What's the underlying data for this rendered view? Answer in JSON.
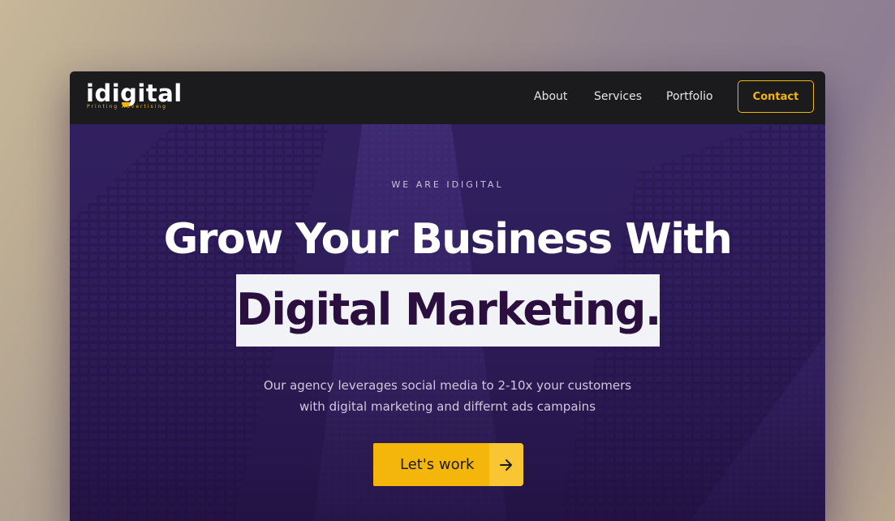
{
  "navbar": {
    "logo": {
      "text": "idigital",
      "tagline": "Printing Advertising"
    },
    "links": [
      "About",
      "Services",
      "Portfolio"
    ],
    "contact_label": "Contact"
  },
  "hero": {
    "eyebrow": "WE ARE IDIGITAL",
    "headline": "Grow Your Business With",
    "highlight": "Digital Marketing.",
    "subtext_line1": "Our agency leverages social media to 2-10x your customers",
    "subtext_line2": "with digital marketing and differnt ads campains",
    "cta_label": "Let's work",
    "cta_icon": "arrow-right-icon"
  },
  "colors": {
    "accent": "#f5b60b",
    "navbar_bg": "#1b1a1c",
    "hero_overlay": "#2f1c5e",
    "highlight_bg": "#f2f3f7",
    "highlight_text": "#2a0f3f"
  }
}
